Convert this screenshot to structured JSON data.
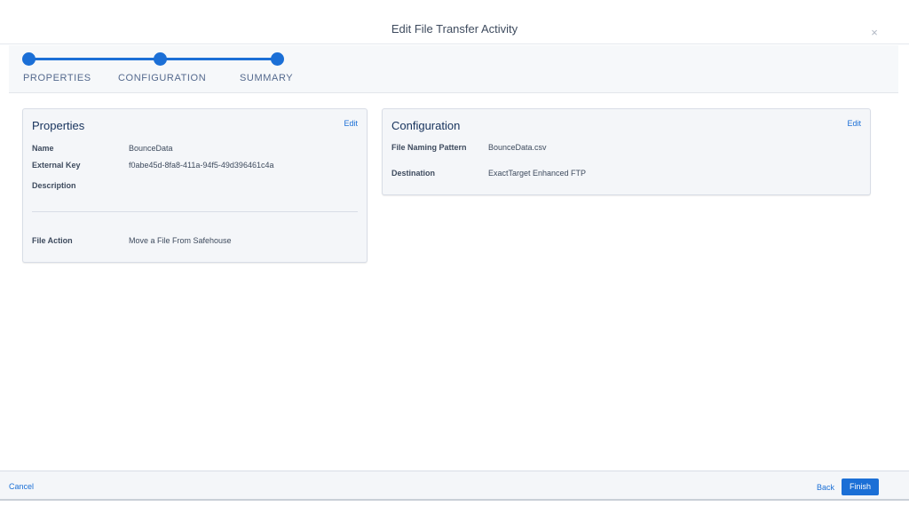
{
  "modal": {
    "title": "Edit File Transfer Activity",
    "close_icon": "×"
  },
  "stepper": {
    "steps": [
      {
        "label": "PROPERTIES",
        "state": "complete"
      },
      {
        "label": "CONFIGURATION",
        "state": "complete"
      },
      {
        "label": "SUMMARY",
        "state": "current"
      }
    ],
    "accent_color": "#1b6fd6"
  },
  "properties_card": {
    "title": "Properties",
    "edit_label": "Edit",
    "fields": {
      "name_label": "Name",
      "name_value": "BounceData",
      "external_key_label": "External Key",
      "external_key_value": "f0abe45d-8fa8-411a-94f5-49d396461c4a",
      "description_label": "Description",
      "description_value": "",
      "file_action_label": "File Action",
      "file_action_value": "Move a File From Safehouse"
    }
  },
  "configuration_card": {
    "title": "Configuration",
    "edit_label": "Edit",
    "fields": {
      "naming_pattern_label": "File Naming Pattern",
      "naming_pattern_value": "BounceData.csv",
      "destination_label": "Destination",
      "destination_value": "ExactTarget Enhanced FTP"
    }
  },
  "footer": {
    "cancel_label": "Cancel",
    "back_label": "Back",
    "finish_label": "Finish"
  }
}
